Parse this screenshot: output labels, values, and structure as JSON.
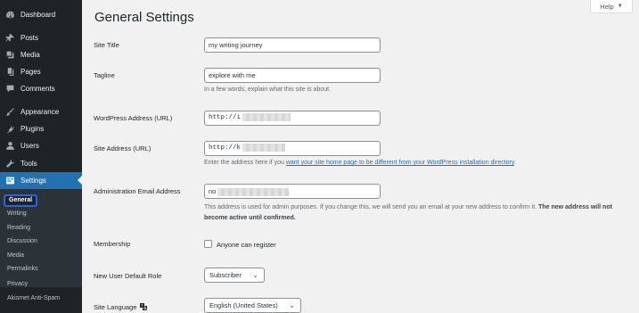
{
  "sidebar": {
    "items": [
      {
        "label": "Dashboard",
        "icon": "dashboard-icon"
      },
      {
        "label": "Posts",
        "icon": "pin-icon"
      },
      {
        "label": "Media",
        "icon": "media-icon"
      },
      {
        "label": "Pages",
        "icon": "pages-icon"
      },
      {
        "label": "Comments",
        "icon": "comment-icon"
      },
      {
        "label": "Appearance",
        "icon": "brush-icon"
      },
      {
        "label": "Plugins",
        "icon": "plug-icon"
      },
      {
        "label": "Users",
        "icon": "user-icon"
      },
      {
        "label": "Tools",
        "icon": "wrench-icon"
      },
      {
        "label": "Settings",
        "icon": "settings-icon",
        "active": true
      }
    ],
    "submenu": [
      "General",
      "Writing",
      "Reading",
      "Discussion",
      "Media",
      "Permalinks",
      "Privacy",
      "Akismet Anti-Spam"
    ],
    "submenu_current": "General"
  },
  "header": {
    "title": "General Settings",
    "help": "Help"
  },
  "form": {
    "site_title": {
      "label": "Site Title",
      "value": "my writing journey"
    },
    "tagline": {
      "label": "Tagline",
      "value": "explore with me",
      "description": "In a few words, explain what this site is about."
    },
    "wp_address": {
      "label": "WordPress Address (URL)",
      "value": "http://i"
    },
    "site_address": {
      "label": "Site Address (URL)",
      "value": "http://k",
      "desc_before": "Enter the address here if you ",
      "desc_link": "want your site home page to be different from your WordPress installation directory",
      "desc_after": "."
    },
    "admin_email": {
      "label": "Administration Email Address",
      "value": "no",
      "desc_plain": "This address is used for admin purposes. If you change this, we will send you an email at your new address to confirm it. ",
      "desc_bold": "The new address will not become active until confirmed."
    },
    "membership": {
      "label": "Membership",
      "checkbox_label": "Anyone can register",
      "checked": false
    },
    "default_role": {
      "label": "New User Default Role",
      "value": "Subscriber"
    },
    "site_language": {
      "label": "Site Language",
      "value": "English (United States)"
    }
  },
  "colors": {
    "sidebar": "#1d2327",
    "accent": "#2271b1",
    "highlight_box": "#2a63e8"
  }
}
